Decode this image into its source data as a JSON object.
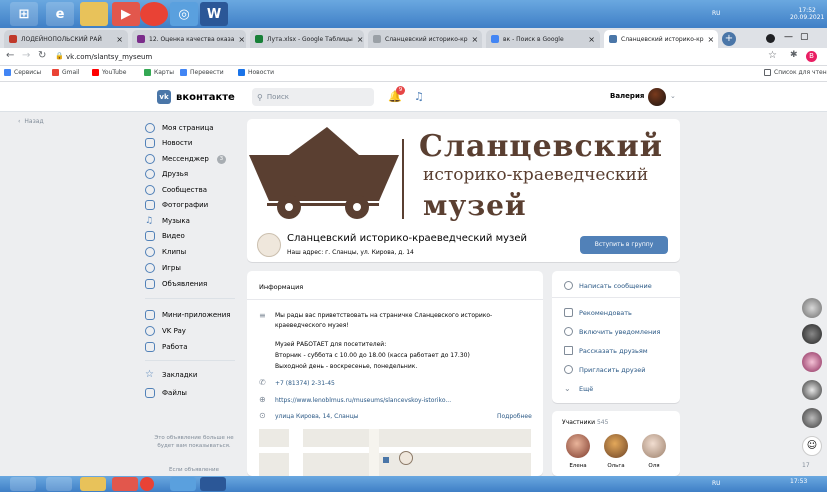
{
  "os": {
    "lang": "RU",
    "time": "17:52",
    "date": "20.09.2021",
    "time_bottom": "17:53"
  },
  "tabs": [
    {
      "label": "ЛОДЕЙНОПОЛЬСКИЙ РАЙ",
      "color": "#c0392b"
    },
    {
      "label": "12. Оценка качества оказа",
      "color": "#7b2d8b"
    },
    {
      "label": "Лута.xlsx - Google Таблицы",
      "color": "#188038"
    },
    {
      "label": "Сланцевский историко-кр",
      "color": "#9aa0a6"
    },
    {
      "label": "вк - Поиск в Google",
      "color": "#4285f4"
    },
    {
      "label": "Сланцевский историко-кр",
      "color": "#4a76a8"
    }
  ],
  "address": {
    "url": "vk.com/slantsy_myseum"
  },
  "bookmarks": [
    "Сервисы",
    "Gmail",
    "YouTube",
    "Карты",
    "Перевести",
    "Новости"
  ],
  "bookmarks_right": "Список для чтен",
  "vk": {
    "logo": "вконтакте",
    "search_placeholder": "Поиск",
    "user_name": "Валерия",
    "notif_count": "9",
    "back": "Назад"
  },
  "sidebar": [
    {
      "label": "Моя страница",
      "icon": "user-icon"
    },
    {
      "label": "Новости",
      "icon": "news-icon"
    },
    {
      "label": "Мессенджер",
      "icon": "message-icon",
      "badge": "3"
    },
    {
      "label": "Друзья",
      "icon": "friends-icon"
    },
    {
      "label": "Сообщества",
      "icon": "groups-icon"
    },
    {
      "label": "Фотографии",
      "icon": "photo-icon"
    },
    {
      "label": "Музыка",
      "icon": "music-icon"
    },
    {
      "label": "Видео",
      "icon": "video-icon"
    },
    {
      "label": "Клипы",
      "icon": "clips-icon"
    },
    {
      "label": "Игры",
      "icon": "games-icon"
    },
    {
      "label": "Объявления",
      "icon": "ads-icon"
    },
    {
      "label": "Мини-приложения",
      "icon": "apps-icon"
    },
    {
      "label": "VK Pay",
      "icon": "pay-icon"
    },
    {
      "label": "Работа",
      "icon": "work-icon"
    },
    {
      "label": "Закладки",
      "icon": "star-icon"
    },
    {
      "label": "Файлы",
      "icon": "file-icon"
    }
  ],
  "sidebar_ad": "Это объявление больше не будет вам показываться.",
  "sidebar_ad2": "Если объявление",
  "cover": {
    "line1": "Сланцевский",
    "line2": "историко-краеведческий",
    "line3": "музей"
  },
  "group": {
    "name": "Сланцевский историко-краеведческий музей",
    "address": "Наш адрес: г. Сланцы, ул. Кирова, д. 14",
    "join": "Вступить в группу"
  },
  "info": {
    "title": "Информация",
    "welcome": "Мы рады вас приветствовать на страничке Сланцевского историко-краеведческого музея!",
    "hours_title": "Музей РАБОТАЕТ для посетителей:",
    "hours": "Вторник - суббота с 10.00 до 18.00 (касса работает до 17.30)",
    "dayoff": "Выходной день - воскресенье, понедельник.",
    "phone": "+7 (81374) 2-31-45",
    "site": "https://www.lenoblmus.ru/museums/slancevskoy-istoriko...",
    "location": "улица Кирова, 14, Сланцы",
    "more": "Подробнее"
  },
  "actions": [
    "Написать сообщение",
    "Рекомендовать",
    "Включить уведомления",
    "Рассказать друзьям",
    "Пригласить друзей",
    "Ещё"
  ],
  "members": {
    "title": "Участники",
    "count": "545",
    "names": [
      "Елена",
      "Ольга",
      "Оля"
    ]
  },
  "chat_count": "17"
}
